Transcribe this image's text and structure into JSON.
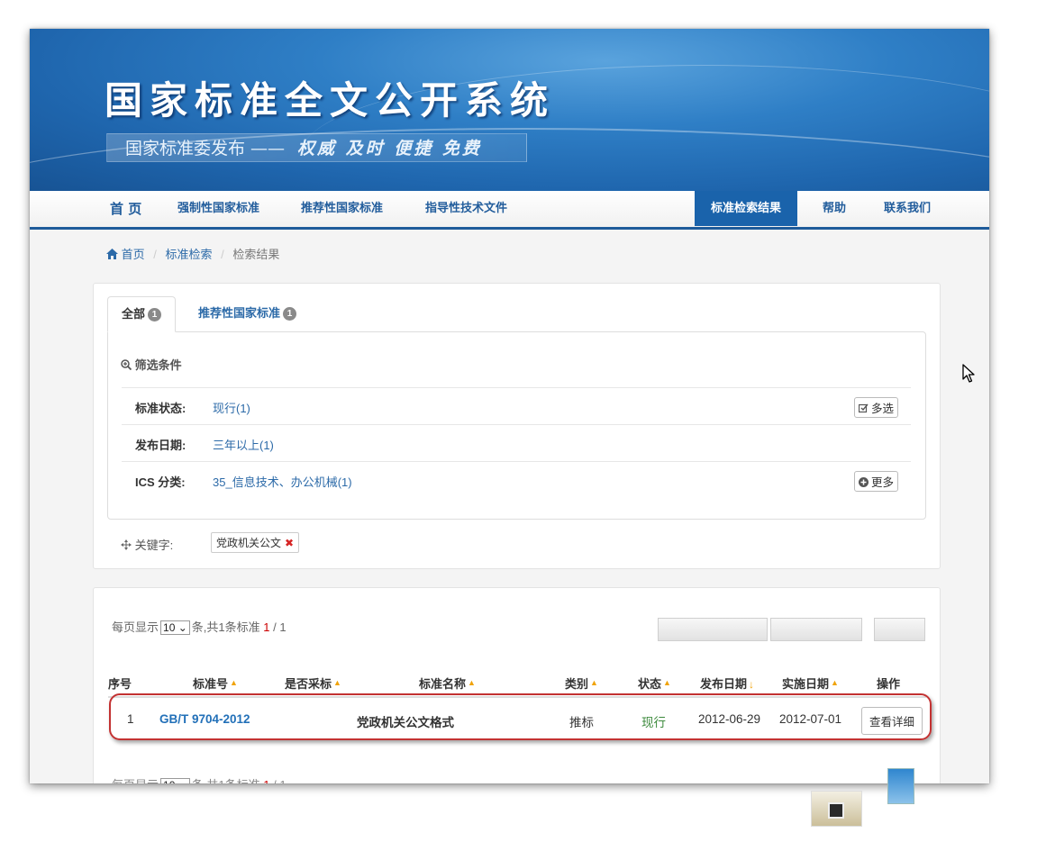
{
  "header": {
    "site_title": "国家标准全文公开系统",
    "slogan_left": "国家标准委发布 ——",
    "slogan_right": "权威 及时 便捷 免费"
  },
  "nav": {
    "items": [
      {
        "label": "首 页"
      },
      {
        "label": "强制性国家标准"
      },
      {
        "label": "推荐性国家标准"
      },
      {
        "label": "指导性技术文件"
      },
      {
        "label": "标准检索结果"
      },
      {
        "label": "帮助"
      },
      {
        "label": "联系我们"
      }
    ],
    "active_index": 4
  },
  "breadcrumb": {
    "home": "首页",
    "sep": "/",
    "search": "标准检索",
    "current": "检索结果"
  },
  "tabs": {
    "all_label": "全部",
    "all_count": "1",
    "rec_label": "推荐性国家标准",
    "rec_count": "1"
  },
  "filters": {
    "title": "筛选条件",
    "rows": [
      {
        "label": "标准状态:",
        "value": "现行(1)",
        "button": "多选"
      },
      {
        "label": "发布日期:",
        "value": "三年以上(1)",
        "button": ""
      },
      {
        "label": "ICS 分类:",
        "value": "35_信息技术、办公机械(1)",
        "button": "更多"
      }
    ]
  },
  "keyword": {
    "label": "关键字:",
    "value": "党政机关公文"
  },
  "pager": {
    "prefix": "每页显示",
    "per_page": "10",
    "mid": "条,共",
    "total": "1",
    "suffix": "条标准",
    "current_page": "1",
    "page_sep": "/",
    "total_pages": "1"
  },
  "table": {
    "headers": [
      "序号",
      "标准号",
      "是否采标",
      "标准名称",
      "类别",
      "状态",
      "发布日期",
      "实施日期",
      "操作"
    ],
    "rows": [
      {
        "index": "1",
        "code": "GB/T 9704-2012",
        "adopted": "",
        "name": "党政机关公文格式",
        "category": "推标",
        "status": "现行",
        "publish_date": "2012-06-29",
        "effective_date": "2012-07-01",
        "action": "查看详细"
      }
    ]
  },
  "colors": {
    "header_blue": "#2f7fc6",
    "nav_active": "#1a63ab",
    "link": "#2c6aa8",
    "status_green": "#3c8a3c",
    "sort_arrow": "#f0a30a",
    "highlight_red": "#c33232"
  }
}
